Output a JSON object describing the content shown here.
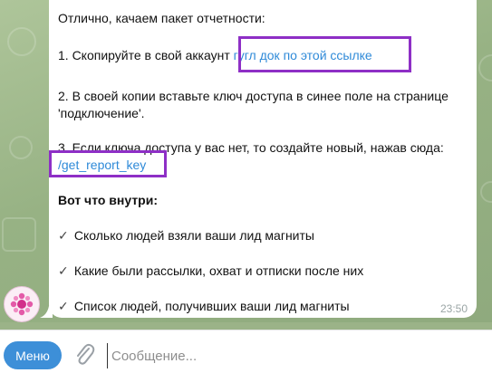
{
  "message": {
    "intro": "Отлично, качаем пакет отчетности:",
    "step1_text": "1. Скопируйте в свой аккаунт ",
    "step1_link": "гугл док по этой ссылке",
    "step2_line1": "2. В своей копии вставьте ключ доступа в синее поле на странице",
    "step2_line2": "'подключение'.",
    "step3_text": "3. Если ключа доступа у вас нет, то создайте новый, нажав сюда:",
    "step3_command": "/get_report_key",
    "inside_title": "Вот что внутри:",
    "bullets": [
      "Сколько людей взяли ваши лид магниты",
      "Какие были рассылки, охват и отписки после них",
      "Список людей, получивших ваши лид магниты"
    ],
    "check_glyph": "✓",
    "time": "23:50"
  },
  "input_bar": {
    "menu_label": "Меню",
    "placeholder": "Сообщение..."
  },
  "colors": {
    "link": "#2f8ad8",
    "highlight": "#8e2fc6",
    "menu_button": "#3d8fd8"
  }
}
